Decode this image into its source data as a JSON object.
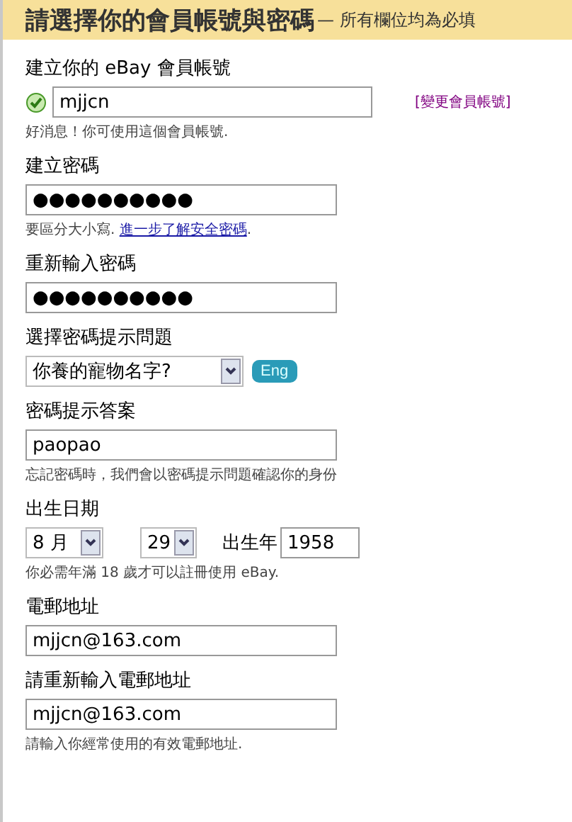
{
  "header": {
    "title": "請選擇你的會員帳號與密碼",
    "subtitle": "— 所有欄位均為必填"
  },
  "fields": [
    {
      "kind": "username",
      "label": "建立你的 eBay 會員帳號",
      "value": "mjjcn",
      "valid": true,
      "link": "[變更會員帳號]",
      "hint": "好消息！你可使用這個會員帳號."
    },
    {
      "kind": "text",
      "label": "建立密碼",
      "value": "●●●●●●●●●●",
      "hint": "要區分大小寫. ",
      "hint_link": "進一步了解安全密碼",
      "hint_end": "."
    },
    {
      "kind": "text",
      "label": "重新輸入密碼",
      "value": "●●●●●●●●●●"
    },
    {
      "kind": "select",
      "label": "選擇密碼提示問題",
      "value": "你養的寵物名字?",
      "button": "Eng"
    },
    {
      "kind": "text",
      "label": "密碼提示答案",
      "value": "paopao",
      "hint": "忘記密碼時，我們會以密碼提示問題確認你的身份"
    },
    {
      "kind": "date",
      "label": "出生日期",
      "month": "8 月",
      "day": "29",
      "year_label": "出生年",
      "year": "1958",
      "hint": "你必需年滿 18 歲才可以註冊使用 eBay."
    },
    {
      "kind": "text",
      "label": "電郵地址",
      "value": "mjjcn@163.com"
    },
    {
      "kind": "text",
      "label": "請重新輸入電郵地址",
      "value": "mjjcn@163.com",
      "hint": "請輸入你經常使用的有效電郵地址."
    }
  ]
}
